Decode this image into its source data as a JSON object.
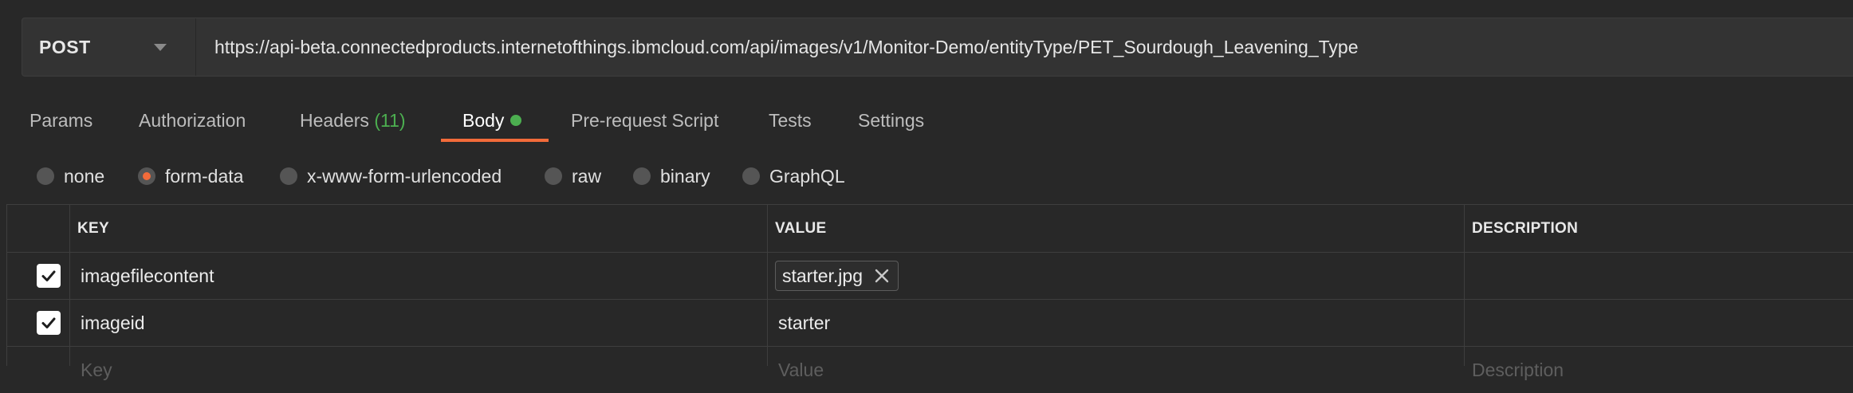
{
  "request": {
    "method": "POST",
    "url": "https://api-beta.connectedproducts.internetofthings.ibmcloud.com/api/images/v1/Monitor-Demo/entityType/PET_Sourdough_Leavening_Type"
  },
  "tabs": [
    {
      "label": "Params"
    },
    {
      "label": "Authorization"
    },
    {
      "label": "Headers",
      "count": "(11)"
    },
    {
      "label": "Body",
      "active": true
    },
    {
      "label": "Pre-request Script"
    },
    {
      "label": "Tests"
    },
    {
      "label": "Settings"
    }
  ],
  "body_types": [
    {
      "label": "none"
    },
    {
      "label": "form-data",
      "selected": true
    },
    {
      "label": "x-www-form-urlencoded"
    },
    {
      "label": "raw"
    },
    {
      "label": "binary"
    },
    {
      "label": "GraphQL"
    }
  ],
  "table": {
    "headers": {
      "key": "KEY",
      "value": "VALUE",
      "description": "DESCRIPTION"
    },
    "rows": [
      {
        "checked": true,
        "key": "imagefilecontent",
        "value": "starter.jpg",
        "value_type": "file",
        "description": ""
      },
      {
        "checked": true,
        "key": "imageid",
        "value": "starter",
        "value_type": "text",
        "description": ""
      }
    ],
    "new_row": {
      "key_placeholder": "Key",
      "value_placeholder": "Value",
      "description_placeholder": "Description"
    }
  },
  "colors": {
    "accent": "#f26b3a",
    "active_dot": "#4caf50",
    "background": "#282828"
  }
}
